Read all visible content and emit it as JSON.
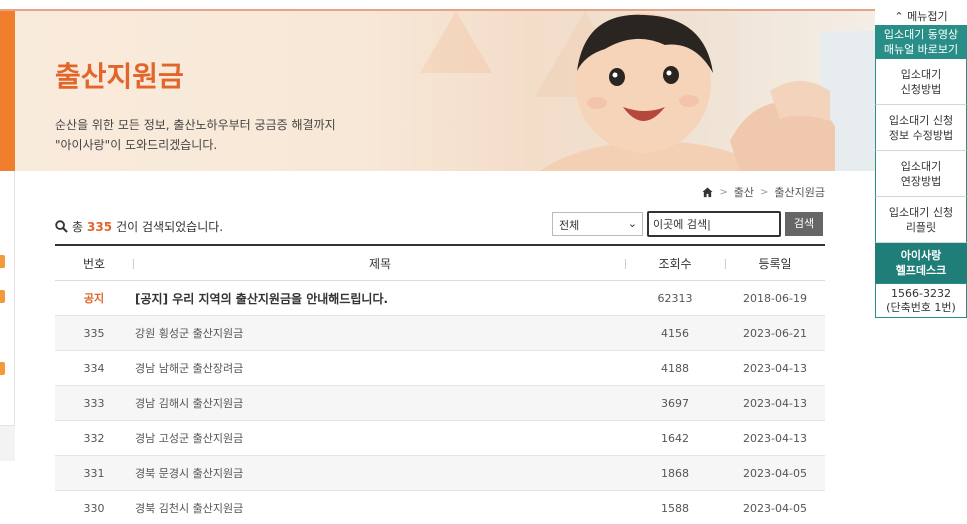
{
  "banner": {
    "title": "출산지원금",
    "subtitle_line1": "순산을 위한 모든 정보, 출산노하우부터 궁금증 해결까지",
    "subtitle_line2": "\"아이사랑\"이 도와드리겠습니다."
  },
  "breadcrumb": {
    "home_icon": "home-icon",
    "items": [
      "출산",
      "출산지원금"
    ]
  },
  "search": {
    "result_prefix": "총",
    "result_count": "335",
    "result_suffix": "건이 검색되었습니다.",
    "select_value": "전체",
    "input_value": "이곳에 검색|",
    "button_label": "검색"
  },
  "table": {
    "headers": {
      "no": "번호",
      "title": "제목",
      "views": "조회수",
      "date": "등록일"
    },
    "notice": {
      "no": "공지",
      "title": "[공지] 우리 지역의 출산지원금을 안내해드립니다.",
      "views": "62313",
      "date": "2018-06-19"
    },
    "rows": [
      {
        "no": "335",
        "title": "강원 횡성군 출산지원금",
        "views": "4156",
        "date": "2023-06-21"
      },
      {
        "no": "334",
        "title": "경남 남해군 출산장려금",
        "views": "4188",
        "date": "2023-04-13"
      },
      {
        "no": "333",
        "title": "경남 김해시 출산지원금",
        "views": "3697",
        "date": "2023-04-13"
      },
      {
        "no": "332",
        "title": "경남 고성군 출산지원금",
        "views": "1642",
        "date": "2023-04-13"
      },
      {
        "no": "331",
        "title": "경북 문경시 출산지원금",
        "views": "1868",
        "date": "2023-04-05"
      },
      {
        "no": "330",
        "title": "경북 김천시 출산지원금",
        "views": "1588",
        "date": "2023-04-05"
      }
    ]
  },
  "side_menu": {
    "collapse_label": "메뉴접기",
    "video_manual_line1": "입소대기 동영상",
    "video_manual_line2": "매뉴얼 바로보기",
    "items": [
      {
        "line1": "입소대기",
        "line2": "신청방법"
      },
      {
        "line1": "입소대기 신청",
        "line2": "정보 수정방법"
      },
      {
        "line1": "입소대기",
        "line2": "연장방법"
      },
      {
        "line1": "입소대기 신청",
        "line2": "리플릿"
      }
    ],
    "helpdesk_line1": "아이사랑",
    "helpdesk_line2": "헬프데스크",
    "phone": "1566-3232",
    "phone_note": "(단축번호 1번)"
  },
  "colors": {
    "accent": "#e2662b",
    "teal": "#2a8e88",
    "left_strip": "#f07e2c"
  }
}
